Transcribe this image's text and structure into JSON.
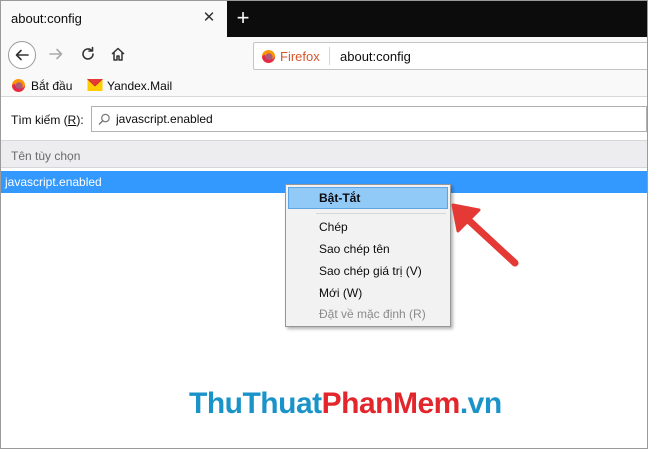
{
  "tab": {
    "title": "about:config"
  },
  "urlbar": {
    "brand": "Firefox",
    "url": "about:config"
  },
  "bookmarks": [
    {
      "label": "Bắt đầu",
      "icon": "firefox-icon"
    },
    {
      "label": "Yandex.Mail",
      "icon": "mail-icon"
    }
  ],
  "search": {
    "label_pre": "Tìm kiếm (",
    "label_key": "R",
    "label_post": "):",
    "value": "javascript.enabled"
  },
  "table": {
    "column_header": "Tên tùy chọn",
    "selected_row": "javascript.enabled"
  },
  "context_menu": {
    "items": [
      {
        "label": "Bật-Tắt",
        "highlighted": true
      },
      {
        "label": "Chép"
      },
      {
        "label": "Sao chép tên"
      },
      {
        "label": "Sao chép giá trị (V)"
      },
      {
        "label": "Mới (W)"
      },
      {
        "label": "Đặt về mặc định (R)",
        "disabled": true
      }
    ]
  },
  "watermark": {
    "part1": "ThuThuat",
    "part2": "PhanMem",
    "part3": ".vn"
  },
  "colors": {
    "selection": "#3399ff",
    "menu_highlight": "#91c9f7",
    "arrow": "#e53935",
    "brand": "#d7542b"
  }
}
